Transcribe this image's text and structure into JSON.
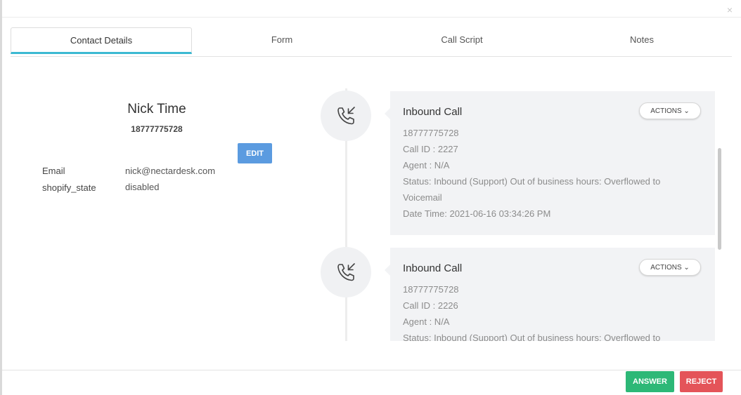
{
  "tabs": [
    {
      "label": "Contact Details",
      "active": true
    },
    {
      "label": "Form",
      "active": false
    },
    {
      "label": "Call Script",
      "active": false
    },
    {
      "label": "Notes",
      "active": false
    }
  ],
  "contact": {
    "name": "Nick Time",
    "phone": "18777775728",
    "edit_label": "EDIT",
    "fields": [
      {
        "label": "Email",
        "value": "nick@nectardesk.com"
      },
      {
        "label": "shopify_state",
        "value": "disabled"
      }
    ]
  },
  "calls": [
    {
      "title": "Inbound Call",
      "actions_label": "ACTIONS",
      "number": "18777775728",
      "call_id": "Call ID : 2227",
      "agent": "Agent : N/A",
      "status_line1": "Status: Inbound (Support) Out of business hours: Overflowed to",
      "status_line2": "Voicemail",
      "datetime": "Date Time: 2021-06-16 03:34:26 PM"
    },
    {
      "title": "Inbound Call",
      "actions_label": "ACTIONS",
      "number": "18777775728",
      "call_id": "Call ID : 2226",
      "agent": "Agent : N/A",
      "status_line1": "Status: Inbound (Support) Out of business hours: Overflowed to"
    }
  ],
  "footer": {
    "answer_label": "ANSWER",
    "reject_label": "REJECT"
  },
  "colors": {
    "tab_active_underline": "#3cb9d2",
    "edit_button": "#5b9be0",
    "answer_button": "#2db877",
    "reject_button": "#e45459"
  },
  "icons": {
    "close": "close-icon",
    "call": "inbound-call-icon",
    "chevron": "chevron-down-icon"
  }
}
